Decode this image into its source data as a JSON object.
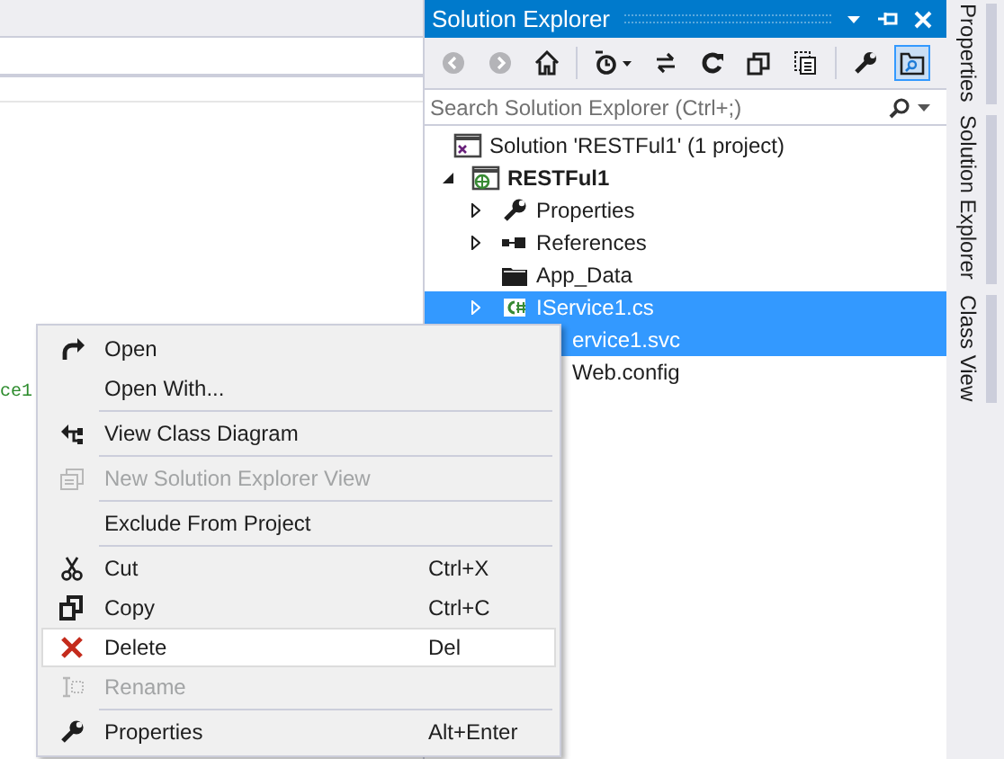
{
  "editor": {
    "code_fragment": "ce1"
  },
  "solution_explorer": {
    "title": "Solution Explorer",
    "search": {
      "placeholder": "Search Solution Explorer (Ctrl+;)"
    },
    "toolbar": [
      {
        "kind": "back",
        "disabled": true
      },
      {
        "kind": "forward",
        "disabled": true
      },
      {
        "kind": "home",
        "disabled": false
      },
      {
        "kind": "separator"
      },
      {
        "kind": "history",
        "disabled": false
      },
      {
        "kind": "sync",
        "disabled": false
      },
      {
        "kind": "refresh",
        "disabled": false
      },
      {
        "kind": "collapse",
        "disabled": false
      },
      {
        "kind": "show-all",
        "disabled": false
      },
      {
        "kind": "separator"
      },
      {
        "kind": "properties",
        "disabled": false
      },
      {
        "kind": "preview",
        "disabled": false,
        "selected": true
      }
    ],
    "tree": [
      {
        "kind": "solution",
        "label": "Solution 'RESTFul1' (1 project)",
        "selected": false,
        "children": [
          {
            "kind": "project",
            "label": "RESTFul1",
            "selected": false,
            "expanded": true,
            "children": [
              {
                "kind": "properties",
                "label": "Properties",
                "selected": false,
                "expanded": false
              },
              {
                "kind": "references",
                "label": "References",
                "selected": false,
                "expanded": false
              },
              {
                "kind": "folder",
                "label": "App_Data",
                "selected": false
              },
              {
                "kind": "csharp",
                "label": "IService1.cs",
                "selected": true,
                "expanded": false
              },
              {
                "kind": "covered",
                "label": "ervice1.svc",
                "selected": true
              },
              {
                "kind": "covered",
                "label": "Web.config",
                "selected": false
              }
            ]
          }
        ]
      }
    ]
  },
  "side_tabs": [
    {
      "label": "Properties"
    },
    {
      "label": "Solution Explorer"
    },
    {
      "label": "Class View"
    }
  ],
  "context_menu": [
    {
      "kind": "open",
      "label": "Open",
      "disabled": false,
      "hovered": false
    },
    {
      "kind": "none",
      "label": "Open With...",
      "disabled": false,
      "hovered": false,
      "separator_after": true
    },
    {
      "kind": "diagram",
      "label": "View Class Diagram",
      "disabled": false,
      "hovered": false,
      "separator_after": true
    },
    {
      "kind": "newview",
      "label": "New Solution Explorer View",
      "disabled": true,
      "hovered": false,
      "separator_after": true
    },
    {
      "kind": "none",
      "label": "Exclude From Project",
      "disabled": false,
      "hovered": false,
      "separator_after": true
    },
    {
      "kind": "cut",
      "label": "Cut",
      "shortcut": "Ctrl+X",
      "disabled": false,
      "hovered": false
    },
    {
      "kind": "copy",
      "label": "Copy",
      "shortcut": "Ctrl+C",
      "disabled": false,
      "hovered": false
    },
    {
      "kind": "delete",
      "label": "Delete",
      "shortcut": "Del",
      "disabled": false,
      "hovered": true
    },
    {
      "kind": "rename",
      "label": "Rename",
      "disabled": true,
      "hovered": false,
      "separator_after": true
    },
    {
      "kind": "properties",
      "label": "Properties",
      "shortcut": "Alt+Enter",
      "disabled": false,
      "hovered": false
    }
  ]
}
